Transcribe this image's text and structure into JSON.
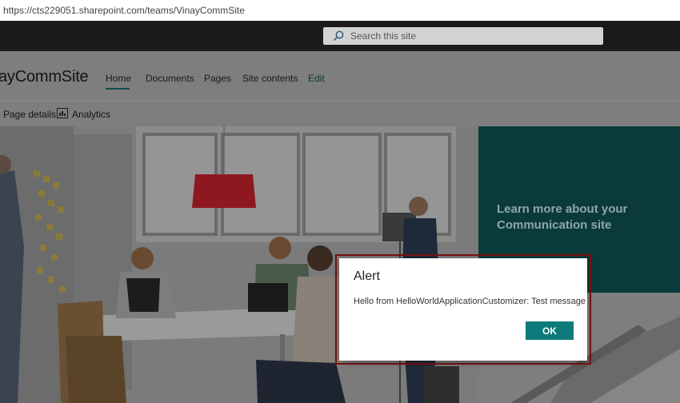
{
  "browser": {
    "url": "https://cts229051.sharepoint.com/teams/VinayCommSite"
  },
  "suite_bar": {
    "search_placeholder": "Search this site"
  },
  "site": {
    "title": "ayCommSite",
    "nav": {
      "home": "Home",
      "documents": "Documents",
      "pages": "Pages",
      "site_contents": "Site contents",
      "edit": "Edit"
    }
  },
  "command_bar": {
    "page_details": "Page details",
    "analytics": "Analytics"
  },
  "hero": {
    "tile_heading": "Learn more about your Communication site"
  },
  "alert": {
    "title": "Alert",
    "message": "Hello from HelloWorldApplicationCustomizer: Test message",
    "ok_label": "OK"
  },
  "colors": {
    "accent": "#0c7a7a",
    "teal_tile": "#0a3a3a",
    "suite_bar": "#1b1b1b"
  }
}
